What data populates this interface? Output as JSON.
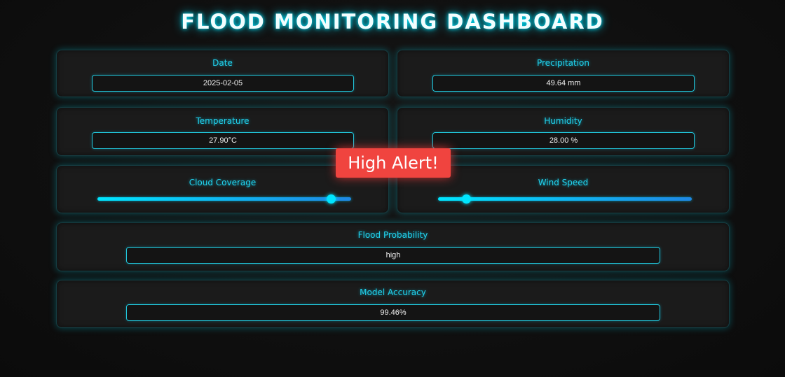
{
  "header": {
    "title": "FLOOD MONITORING DASHBOARD"
  },
  "cards": {
    "date": {
      "label": "Date",
      "value": "2025-02-05"
    },
    "precipitation": {
      "label": "Precipitation",
      "value": "49.64 mm"
    },
    "temperature": {
      "label": "Temperature",
      "value": "27.90°C"
    },
    "humidity": {
      "label": "Humidity",
      "value": "28.00 %"
    },
    "cloud_coverage": {
      "label": "Cloud Coverage",
      "slider_fraction": 0.92
    },
    "wind_speed": {
      "label": "Wind Speed",
      "slider_fraction": 0.11
    },
    "flood_probability": {
      "label": "Flood Probability",
      "value": "high"
    },
    "model_accuracy": {
      "label": "Model Accuracy",
      "value": "99.46%"
    }
  },
  "alert": {
    "text": "High Alert!",
    "color": "#f0443f"
  },
  "colors": {
    "accent": "#22d3ee",
    "background": "#0e0e0e",
    "card": "#1b1b1b"
  }
}
